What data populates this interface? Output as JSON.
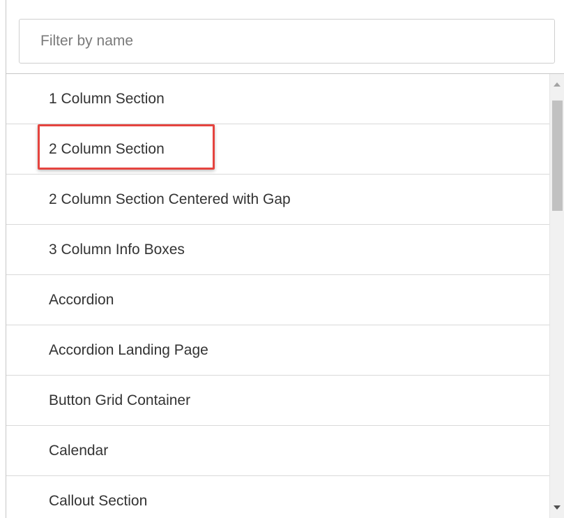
{
  "filter": {
    "placeholder": "Filter by name",
    "value": ""
  },
  "items": [
    {
      "label": "1 Column Section"
    },
    {
      "label": "2 Column Section",
      "highlighted": true
    },
    {
      "label": "2 Column Section Centered with Gap"
    },
    {
      "label": "3 Column Info Boxes"
    },
    {
      "label": "Accordion"
    },
    {
      "label": "Accordion Landing Page"
    },
    {
      "label": "Button Grid Container"
    },
    {
      "label": "Calendar"
    },
    {
      "label": "Callout Section"
    }
  ],
  "colors": {
    "highlight": "#e5443f",
    "text": "#333333",
    "divider": "#d9d9d9"
  }
}
